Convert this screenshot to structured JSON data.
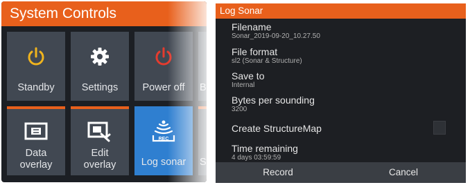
{
  "system_controls": {
    "title": "System Controls",
    "tiles": [
      {
        "label": "Standby",
        "icon": "power-icon"
      },
      {
        "label": "Settings",
        "icon": "gear-icon"
      },
      {
        "label": "Power off",
        "icon": "power-icon"
      },
      {
        "label": "Bri",
        "icon": ""
      },
      {
        "label": "Data\noverlay",
        "icon": "data-overlay-icon"
      },
      {
        "label": "Edit\noverlay",
        "icon": "edit-overlay-icon"
      },
      {
        "label": "Log sonar",
        "icon": "log-sonar-icon"
      },
      {
        "label": "St",
        "icon": ""
      }
    ],
    "colors": {
      "header": "#e8601c",
      "tile": "#414852",
      "active_tile": "#2f7fd0",
      "standby_icon": "#f0b41e",
      "power_off_icon": "#e53b2e"
    }
  },
  "log_sonar": {
    "title": "Log Sonar",
    "fields": [
      {
        "label": "Filename",
        "value": "Sonar_2019-09-20_10.27.50"
      },
      {
        "label": "File format",
        "value": "sl2 (Sonar & Structure)"
      },
      {
        "label": "Save to",
        "value": "Internal"
      },
      {
        "label": "Bytes per sounding",
        "value": "3200"
      },
      {
        "label": "Create StructureMap",
        "value": ""
      },
      {
        "label": "Time remaining",
        "value": "4 days 03:59:59"
      }
    ],
    "buttons": {
      "record": "Record",
      "cancel": "Cancel"
    }
  }
}
